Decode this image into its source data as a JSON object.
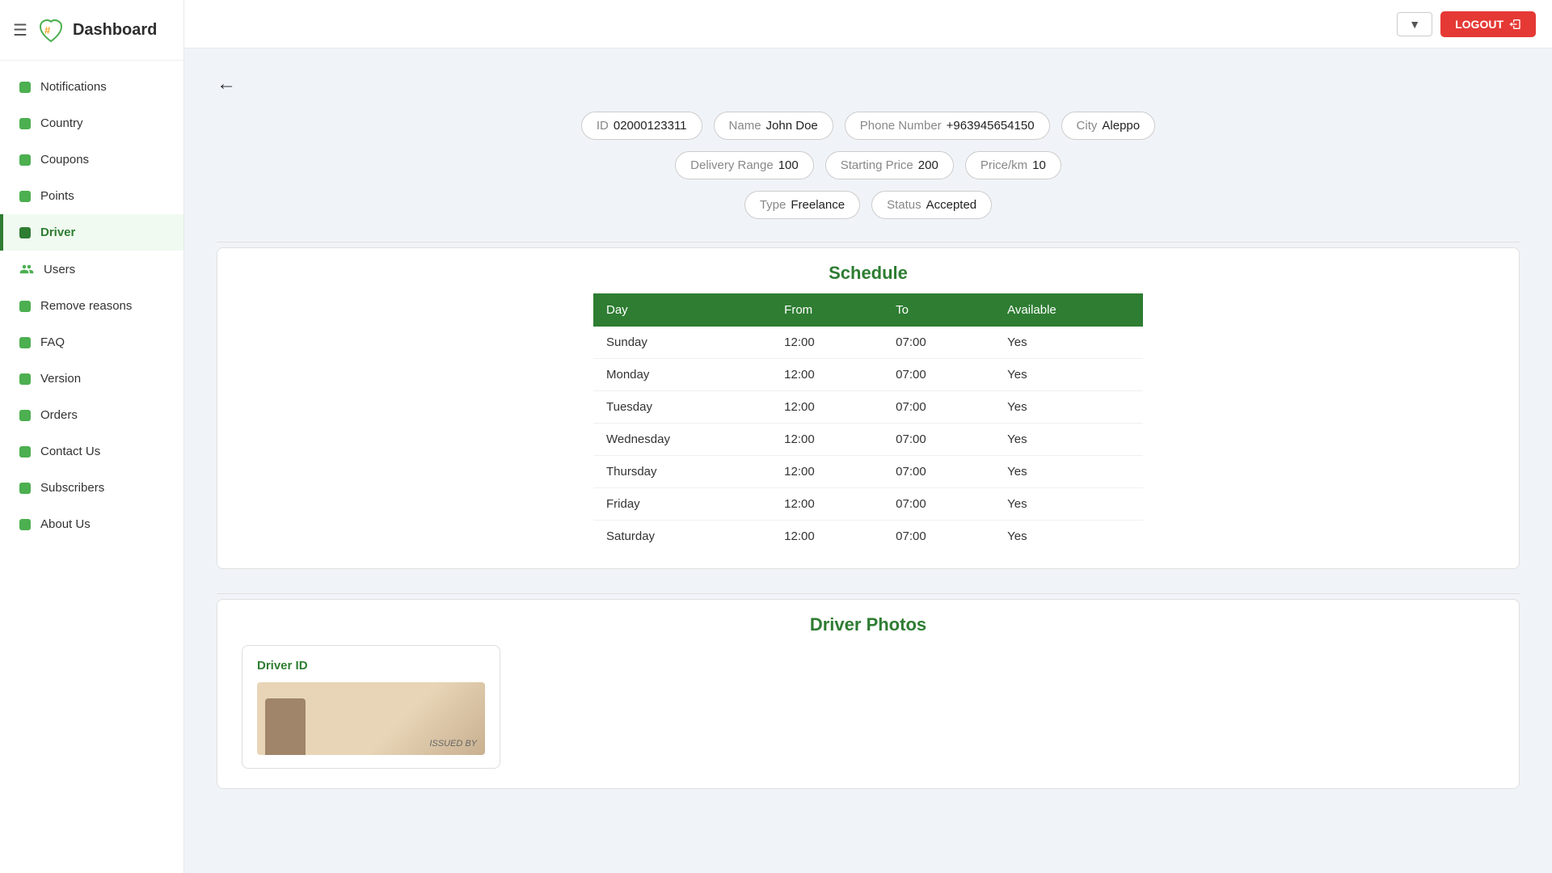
{
  "app": {
    "title": "Dashboard",
    "logo_alt": "Dashboard Logo"
  },
  "topbar": {
    "dropdown_label": "▼",
    "logout_label": "LOGOUT"
  },
  "sidebar": {
    "items": [
      {
        "id": "notifications",
        "label": "Notifications",
        "active": false,
        "type": "dot"
      },
      {
        "id": "country",
        "label": "Country",
        "active": false,
        "type": "dot"
      },
      {
        "id": "coupons",
        "label": "Coupons",
        "active": false,
        "type": "dot"
      },
      {
        "id": "points",
        "label": "Points",
        "active": false,
        "type": "dot"
      },
      {
        "id": "driver",
        "label": "Driver",
        "active": true,
        "type": "dot"
      },
      {
        "id": "users",
        "label": "Users",
        "active": false,
        "type": "users"
      },
      {
        "id": "remove-reasons",
        "label": "Remove reasons",
        "active": false,
        "type": "dot"
      },
      {
        "id": "faq",
        "label": "FAQ",
        "active": false,
        "type": "dot"
      },
      {
        "id": "version",
        "label": "Version",
        "active": false,
        "type": "dot"
      },
      {
        "id": "orders",
        "label": "Orders",
        "active": false,
        "type": "dot"
      },
      {
        "id": "contact-us",
        "label": "Contact Us",
        "active": false,
        "type": "dot"
      },
      {
        "id": "subscribers",
        "label": "Subscribers",
        "active": false,
        "type": "dot"
      },
      {
        "id": "about-us",
        "label": "About Us",
        "active": false,
        "type": "dot"
      }
    ]
  },
  "driver": {
    "id_label": "ID",
    "id_value": "02000123311",
    "name_label": "Name",
    "name_value": "John Doe",
    "phone_label": "Phone Number",
    "phone_value": "+963945654150",
    "city_label": "City",
    "city_value": "Aleppo",
    "delivery_range_label": "Delivery Range",
    "delivery_range_value": "100",
    "starting_price_label": "Starting Price",
    "starting_price_value": "200",
    "price_km_label": "Price/km",
    "price_km_value": "10",
    "type_label": "Type",
    "type_value": "Freelance",
    "status_label": "Status",
    "status_value": "Accepted"
  },
  "schedule": {
    "title": "Schedule",
    "columns": [
      "Day",
      "From",
      "To",
      "Available"
    ],
    "rows": [
      {
        "day": "Sunday",
        "from": "12:00",
        "to": "07:00",
        "available": "Yes"
      },
      {
        "day": "Monday",
        "from": "12:00",
        "to": "07:00",
        "available": "Yes"
      },
      {
        "day": "Tuesday",
        "from": "12:00",
        "to": "07:00",
        "available": "Yes"
      },
      {
        "day": "Wednesday",
        "from": "12:00",
        "to": "07:00",
        "available": "Yes"
      },
      {
        "day": "Thursday",
        "from": "12:00",
        "to": "07:00",
        "available": "Yes"
      },
      {
        "day": "Friday",
        "from": "12:00",
        "to": "07:00",
        "available": "Yes"
      },
      {
        "day": "Saturday",
        "from": "12:00",
        "to": "07:00",
        "available": "Yes"
      }
    ]
  },
  "photos": {
    "title": "Driver Photos",
    "driver_id_label": "Driver ID",
    "issued_by": "ISSUED BY"
  }
}
